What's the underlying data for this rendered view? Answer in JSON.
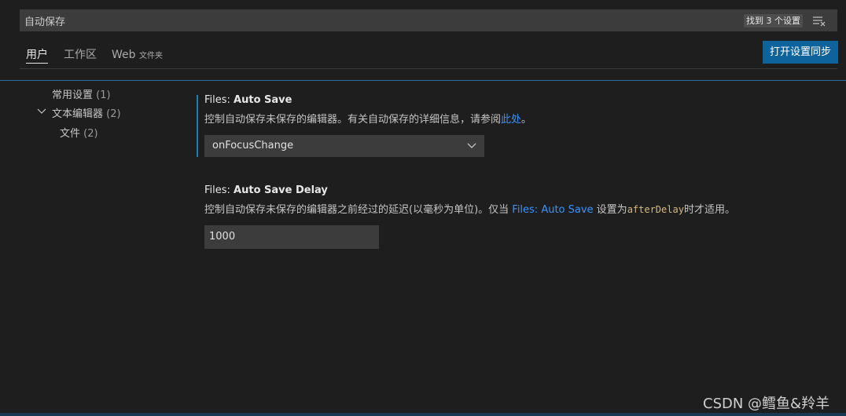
{
  "search": {
    "value": "自动保存",
    "result_count": "找到 3 个设置",
    "clear_icon": "clear-filter-icon"
  },
  "tabs": [
    {
      "label": "用户",
      "active": true
    },
    {
      "label": "工作区",
      "active": false
    },
    {
      "label": "Web",
      "sub": "文件夹",
      "active": false
    }
  ],
  "sync_button": "打开设置同步",
  "toc": [
    {
      "label": "常用设置",
      "count": "(1)"
    },
    {
      "label": "文本编辑器",
      "count": "(2)",
      "expanded": true
    },
    {
      "label": "文件",
      "count": "(2)"
    }
  ],
  "settings": {
    "auto_save": {
      "category": "Files: ",
      "name": "Auto Save",
      "desc": "控制自动保存未保存的编辑器。有关自动保存的详细信息，请参阅",
      "link": "此处",
      "desc_end": "。",
      "value": "onFocusChange"
    },
    "auto_save_delay": {
      "category": "Files: ",
      "name": "Auto Save Delay",
      "desc": "控制自动保存未保存的编辑器之前经过的延迟(以毫秒为单位)。仅当 ",
      "link": "Files: Auto Save",
      "desc_mid": " 设置为",
      "code": "afterDelay",
      "desc_end": "时才适用。",
      "value": "1000"
    }
  },
  "watermark": "CSDN @鳕鱼&羚羊",
  "colors": {
    "accent": "#0e639c",
    "link": "#3794ff",
    "focus": "#1b80b2"
  }
}
